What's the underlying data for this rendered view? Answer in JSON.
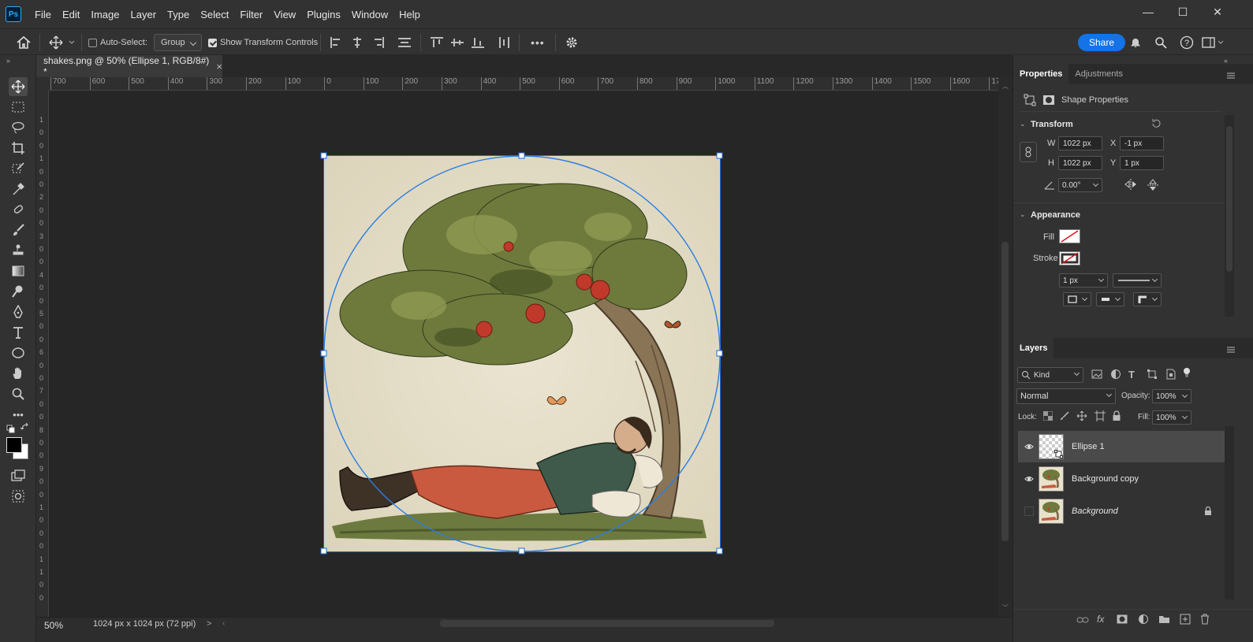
{
  "app": {
    "logo": "Ps",
    "menus": [
      "File",
      "Edit",
      "Image",
      "Layer",
      "Type",
      "Select",
      "Filter",
      "View",
      "Plugins",
      "Window",
      "Help"
    ]
  },
  "window_controls": {
    "minimize": "—",
    "maximize": "☐",
    "close": "✕"
  },
  "options_bar": {
    "auto_select_label": "Auto-Select:",
    "auto_select_checked": false,
    "auto_select_target": "Group",
    "show_transform_label": "Show Transform Controls",
    "show_transform_checked": true,
    "more_label": "•••",
    "share_label": "Share",
    "accent": "#1473e6"
  },
  "document": {
    "tab_title": "shakes.png @ 50% (Ellipse 1, RGB/8#) *",
    "close": "×",
    "h_ruler_labels": [
      "700",
      "600",
      "500",
      "400",
      "300",
      "200",
      "100",
      "0",
      "100",
      "200",
      "300",
      "400",
      "500",
      "600",
      "700",
      "800",
      "900",
      "1000",
      "1100",
      "1200",
      "1300",
      "1400",
      "1500",
      "1600",
      "170"
    ],
    "v_ruler_labels": [
      "1",
      "0",
      "0",
      "1",
      "0",
      "0",
      "2",
      "0",
      "0",
      "3",
      "0",
      "0",
      "4",
      "0",
      "0",
      "5",
      "0",
      "0",
      "6",
      "0",
      "0",
      "7",
      "0",
      "0",
      "8",
      "0",
      "0",
      "9",
      "0",
      "0",
      "1",
      "0",
      "0",
      "0",
      "1",
      "1",
      "0",
      "0"
    ]
  },
  "status": {
    "zoom": "50%",
    "doc_size": "1024 px x 1024 px (72 ppi)",
    "arrow": ">"
  },
  "properties": {
    "tabs": [
      "Properties",
      "Adjustments"
    ],
    "shape_properties_label": "Shape Properties",
    "transform_label": "Transform",
    "w_label": "W",
    "w_value": "1022 px",
    "x_label": "X",
    "x_value": "-1 px",
    "h_label": "H",
    "h_value": "1022 px",
    "y_label": "Y",
    "y_value": "1 px",
    "angle_value": "0.00°",
    "appearance_label": "Appearance",
    "fill_label": "Fill",
    "stroke_label": "Stroke",
    "stroke_width": "1 px"
  },
  "layers": {
    "tab": "Layers",
    "filter_kind": "Kind",
    "blend_mode": "Normal",
    "opacity_label": "Opacity:",
    "opacity_value": "100%",
    "lock_label": "Lock:",
    "fill_label": "Fill:",
    "fill_value": "100%",
    "items": [
      {
        "name": "Ellipse 1",
        "visible": true,
        "selected": true
      },
      {
        "name": "Background copy",
        "visible": true,
        "selected": false
      },
      {
        "name": "Background",
        "visible": false,
        "selected": false,
        "locked": true
      }
    ]
  }
}
